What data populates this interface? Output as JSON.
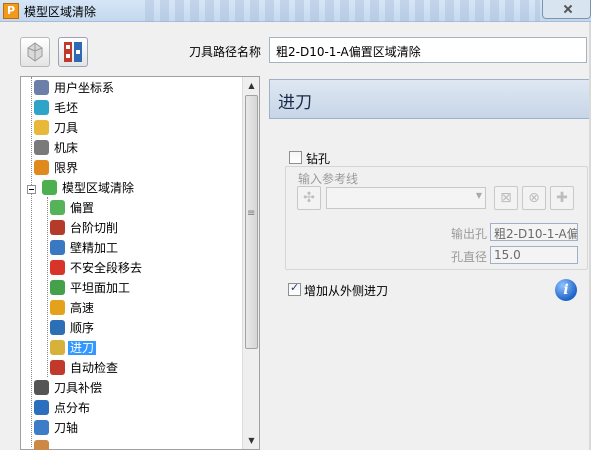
{
  "window": {
    "title": "模型区域清除",
    "app_icon_letter": "P"
  },
  "toolbar": {
    "path_name_label": "刀具路径名称",
    "path_name_value": "粗2-D10-1-A偏置区域清除"
  },
  "tree": {
    "items": [
      {
        "label": "用户坐标系",
        "icon": "ucs-icon"
      },
      {
        "label": "毛坯",
        "icon": "block-icon"
      },
      {
        "label": "刀具",
        "icon": "tool-icon"
      },
      {
        "label": "机床",
        "icon": "machine-icon"
      },
      {
        "label": "限界",
        "icon": "limits-icon"
      },
      {
        "label": "模型区域清除",
        "icon": "area-clear-icon"
      },
      {
        "label": "偏置",
        "icon": "offset-icon"
      },
      {
        "label": "台阶切削",
        "icon": "step-cut-icon"
      },
      {
        "label": "壁精加工",
        "icon": "wall-finish-icon"
      },
      {
        "label": "不安全段移去",
        "icon": "unsafe-remove-icon"
      },
      {
        "label": "平坦面加工",
        "icon": "flat-machining-icon"
      },
      {
        "label": "高速",
        "icon": "high-speed-icon"
      },
      {
        "label": "顺序",
        "icon": "order-icon"
      },
      {
        "label": "进刀",
        "icon": "lead-in-icon"
      },
      {
        "label": "自动检查",
        "icon": "auto-check-icon"
      },
      {
        "label": "刀具补偿",
        "icon": "tool-comp-icon"
      },
      {
        "label": "点分布",
        "icon": "point-dist-icon"
      },
      {
        "label": "刀轴",
        "icon": "tool-axis-icon"
      },
      {
        "label": "",
        "icon": "partial-icon"
      }
    ],
    "selected_label": "进刀"
  },
  "panel": {
    "header": "进刀",
    "drill_label": "钻孔",
    "drill_checked": false,
    "ref_line_group": "输入参考线",
    "exit_hole_label": "输出孔",
    "exit_hole_value": "粗2-D10-1-A偏",
    "hole_diameter_label": "孔直径",
    "hole_diameter_value": "15.0",
    "outside_lead_in_label": "增加从外侧进刀",
    "outside_lead_in_checked": true
  },
  "colors": {
    "selection": "#3399ff",
    "header_text": "#1a2a47",
    "info_blue": "#1e64c8"
  }
}
